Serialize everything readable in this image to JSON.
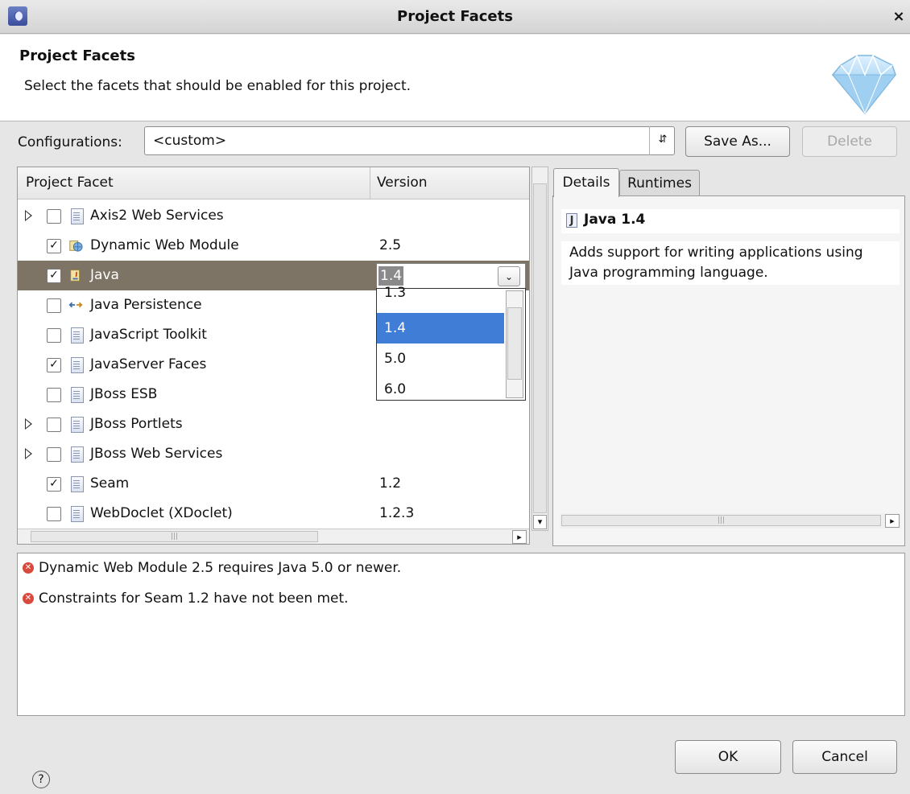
{
  "window": {
    "title": "Project Facets",
    "close_glyph": "×"
  },
  "header": {
    "title": "Project Facets",
    "description": "Select the facets that should be enabled for this project."
  },
  "configurations": {
    "label": "Configurations:",
    "value": "<custom>",
    "save_as_label": "Save As...",
    "delete_label": "Delete"
  },
  "facet_table": {
    "col_facet": "Project Facet",
    "col_version": "Version",
    "rows": [
      {
        "name": "Axis2 Web Services",
        "version": "",
        "checked": false,
        "expandable": true,
        "icon": "doc-icon"
      },
      {
        "name": "Dynamic Web Module",
        "version": "2.5",
        "checked": true,
        "expandable": false,
        "icon": "web-module-icon"
      },
      {
        "name": "Java",
        "version": "1.4",
        "checked": true,
        "expandable": false,
        "icon": "java-icon",
        "selected": true
      },
      {
        "name": "Java Persistence",
        "version": "",
        "checked": false,
        "expandable": false,
        "icon": "persistence-icon"
      },
      {
        "name": "JavaScript Toolkit",
        "version": "",
        "checked": false,
        "expandable": false,
        "icon": "doc-icon"
      },
      {
        "name": "JavaServer Faces",
        "version": "",
        "checked": true,
        "expandable": false,
        "icon": "doc-icon"
      },
      {
        "name": "JBoss ESB",
        "version": "",
        "checked": false,
        "expandable": false,
        "icon": "doc-icon"
      },
      {
        "name": "JBoss Portlets",
        "version": "",
        "checked": false,
        "expandable": true,
        "icon": "doc-icon"
      },
      {
        "name": "JBoss Web Services",
        "version": "",
        "checked": false,
        "expandable": true,
        "icon": "doc-icon"
      },
      {
        "name": "Seam",
        "version": "1.2",
        "checked": true,
        "expandable": false,
        "icon": "doc-icon"
      },
      {
        "name": "WebDoclet (XDoclet)",
        "version": "1.2.3",
        "checked": false,
        "expandable": false,
        "icon": "doc-icon"
      }
    ]
  },
  "version_dropdown": {
    "current": "1.4",
    "options": [
      "1.3",
      "1.4",
      "5.0",
      "6.0"
    ],
    "highlighted": "1.4"
  },
  "details": {
    "tabs": [
      "Details",
      "Runtimes"
    ],
    "active_tab": "Details",
    "heading": "Java 1.4",
    "description": "Adds support for writing applications using Java programming language."
  },
  "problems": [
    "Dynamic Web Module 2.5 requires Java 5.0 or newer.",
    "Constraints for Seam 1.2 have not been met."
  ],
  "buttons": {
    "ok": "OK",
    "cancel": "Cancel",
    "help_glyph": "?"
  },
  "colors": {
    "selection": "#3f7dd6",
    "selected_row": "#7d7466",
    "error": "#d94a3d"
  }
}
